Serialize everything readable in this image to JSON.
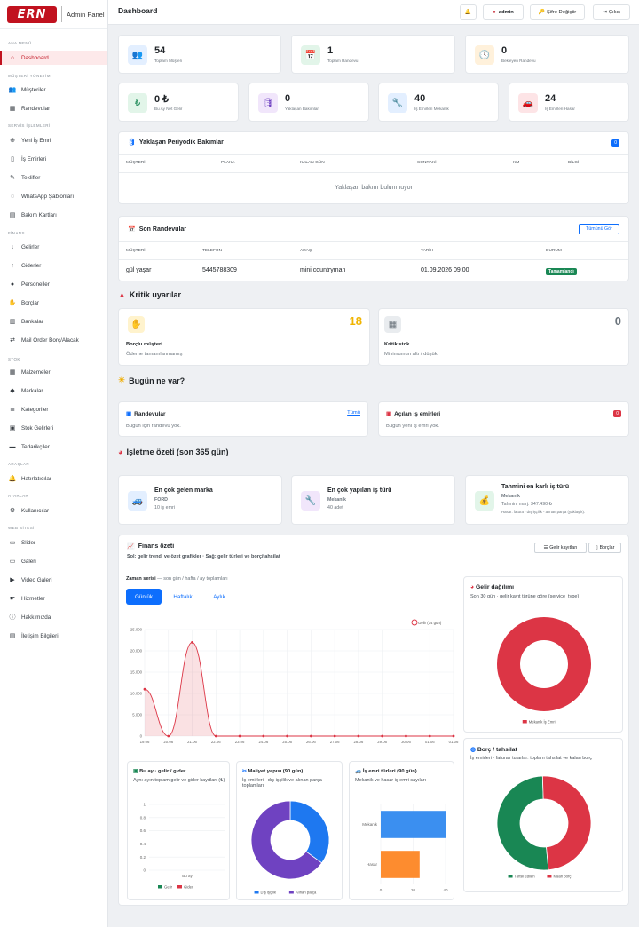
{
  "brand": {
    "logo": "ERN",
    "title": "Admin Panel"
  },
  "sidebar": {
    "sections": {
      "main": "ANA MENÜ",
      "customers": "MÜŞTERİ YÖNETİMİ",
      "service": "SERVİS İŞLEMLERİ",
      "finance": "FİNANS",
      "stock": "STOK",
      "tools": "ARAÇLAR",
      "settings": "AYARLAR",
      "website": "WEB SİTESİ"
    },
    "items": [
      "Dashboard",
      "Müşteriler",
      "Randevular",
      "Yeni İş Emri",
      "İş Emirleri",
      "Teklifler",
      "WhatsApp Şablonları",
      "Bakım Kartları",
      "Gelirler",
      "Giderler",
      "Personeller",
      "Borçlar",
      "Bankalar",
      "Mail Order Borç/Alacak",
      "Malzemeler",
      "Markalar",
      "Kategoriler",
      "Stok Gelirleri",
      "Tedarikçiler",
      "Hatırlatıcılar",
      "Kullanıcılar",
      "Slider",
      "Galeri",
      "Video Galeri",
      "Hizmetler",
      "Hakkımızda",
      "İletişim Bilgileri"
    ]
  },
  "header": {
    "title": "Dashboard",
    "user": "admin",
    "change_password": "Şifre Değiştir",
    "logout": "Çıkış"
  },
  "stats_top": [
    {
      "value": "54",
      "label": "Toplam Müşteri"
    },
    {
      "value": "1",
      "label": "Toplam Randevu"
    },
    {
      "value": "0",
      "label": "Bekleyen Randevu"
    }
  ],
  "stats_mid": [
    {
      "value": "0 ₺",
      "label": "Bu Ay Net Gelir"
    },
    {
      "value": "0",
      "label": "Yaklaşan Bakımlar"
    },
    {
      "value": "40",
      "label": "İş Emirleri Mekanik"
    },
    {
      "value": "24",
      "label": "İş Emirleri Hasar"
    }
  ],
  "maintenance": {
    "title": "Yaklaşan Periyodik Bakımlar",
    "badge": "0",
    "columns": [
      "MÜŞTERİ",
      "PLAKA",
      "KALAN GÜN",
      "SONRAKİ",
      "KM",
      "BİLGİ"
    ],
    "empty": "Yaklaşan bakım bulunmuyor"
  },
  "appointments": {
    "title": "Son Randevular",
    "view_all": "Tümünü Gör",
    "columns": [
      "MÜŞTERİ",
      "TELEFON",
      "ARAÇ",
      "TARİH",
      "DURUM"
    ],
    "rows": [
      {
        "customer": "gül yaşar",
        "phone": "5445788309",
        "vehicle": "mini countryman",
        "date": "01.09.2026 09:00",
        "status": "Tamamlandı"
      }
    ]
  },
  "alerts": {
    "title": "Kritik uyarılar",
    "debt": {
      "value": "18",
      "title": "Borçlu müşteri",
      "desc": "Ödeme tamamlanmamış"
    },
    "stock": {
      "value": "0",
      "title": "Kritik stok",
      "desc": "Minimumun altı / düşük"
    }
  },
  "today": {
    "title": "Bugün ne var?",
    "appointments": {
      "title": "Randevular",
      "link": "Tümü",
      "desc": "Bugün için randevu yok."
    },
    "jobs": {
      "title": "Açılan iş emirleri",
      "badge": "0",
      "desc": "Bugün yeni iş emri yok."
    }
  },
  "summary": {
    "title": "İşletme özeti (son 365 gün)",
    "brand": {
      "title": "En çok gelen marka",
      "name": "FORD",
      "sub": "10 iş emri"
    },
    "job": {
      "title": "En çok yapılan iş türü",
      "name": "Mekanik",
      "sub": "40 adet"
    },
    "profit": {
      "title": "Tahmini en karlı iş türü",
      "name": "Mekanik",
      "margin": "Tahmini marj: 347.490 ₺",
      "note": "Hasar: fatura - dış işçilik - alınan parça (yaklaşık)."
    }
  },
  "finance": {
    "title": "Finans özeti",
    "subtitle": "Sol: gelir trendi ve özet grafikler · Sağ: gelir türleri ve borç/tahsilat",
    "btn_income": "Gelir kayıtları",
    "btn_debts": "Borçlar",
    "ts_label": "Zaman serisi",
    "ts_sub": "— son gün / hafta / ay toplamları",
    "tabs": [
      "Günlük",
      "Haftalık",
      "Aylık"
    ]
  },
  "charts_text": {
    "bars_title": "Bu ay · gelir / gider",
    "bars_sub": "Aynı ayın toplam gelir ve gider kayıtları (₺)",
    "cost_title": "Maliyet yapısı (90 gün)",
    "cost_sub": "İş emirleri · dış işçilik ve alınan parça toplamları",
    "jobs_title": "İş emri türleri (90 gün)",
    "jobs_sub": "Mekanik ve hasar iş emri sayıları",
    "income_title": "Gelir dağılımı",
    "income_sub": "Son 30 gün · gelir kayıt türüne göre (service_type)",
    "debt_title": "Borç / tahsilat",
    "debt_sub": "İş emirleri · faturalı tutarlar: toplam tahsilat ve kalan borç"
  },
  "chart_data": [
    {
      "type": "area",
      "legend": [
        "Gelir (14 gün)"
      ],
      "x": [
        "19.06",
        "20.06",
        "21.06",
        "22.06",
        "23.06",
        "24.06",
        "25.06",
        "26.06",
        "27.06",
        "28.06",
        "29.06",
        "30.06",
        "01.06",
        "01.06"
      ],
      "series": [
        {
          "name": "Gelir (14 gün)",
          "values": [
            11000,
            0,
            22000,
            0,
            0,
            0,
            0,
            0,
            0,
            0,
            0,
            0,
            0,
            0
          ]
        }
      ],
      "ylim": [
        0,
        25000
      ],
      "yticks": [
        "0",
        "5.000",
        "10.000",
        "15.000",
        "20.000",
        "25.000"
      ],
      "color": "#dc3545"
    },
    {
      "type": "bar",
      "categories": [
        "Bu ay"
      ],
      "series": [
        {
          "name": "Gelir",
          "values": [
            0
          ]
        },
        {
          "name": "Gider",
          "values": [
            0
          ]
        }
      ],
      "ylim": [
        0,
        1
      ],
      "yticks": [
        "0",
        "0.2",
        "0.4",
        "0.6",
        "0.8",
        "1"
      ]
    },
    {
      "type": "pie",
      "categories": [
        "Dış işçilik",
        "Alınan parça"
      ],
      "values": [
        35,
        65
      ],
      "colors": [
        "#1e78f0",
        "#6f42c1"
      ]
    },
    {
      "type": "bar",
      "orientation": "horizontal",
      "categories": [
        "Mekanik",
        "Hasar"
      ],
      "values": [
        40,
        24
      ],
      "xlim": [
        0,
        40
      ],
      "xticks": [
        "0",
        "20",
        "40"
      ],
      "colors": [
        "#3b8ff0",
        "#fd8c2f"
      ]
    },
    {
      "type": "pie",
      "categories": [
        "Mekanik İş Emri"
      ],
      "values": [
        100
      ],
      "colors": [
        "#dc3545"
      ]
    },
    {
      "type": "pie",
      "categories": [
        "Tahsil edilen",
        "Kalan borç"
      ],
      "values": [
        51,
        49
      ],
      "colors": [
        "#198754",
        "#dc3545"
      ]
    }
  ],
  "colors": {
    "brand": "#c1121f",
    "primary": "#0d6efd",
    "success": "#198754",
    "danger": "#dc3545",
    "warning": "#ffc107"
  }
}
